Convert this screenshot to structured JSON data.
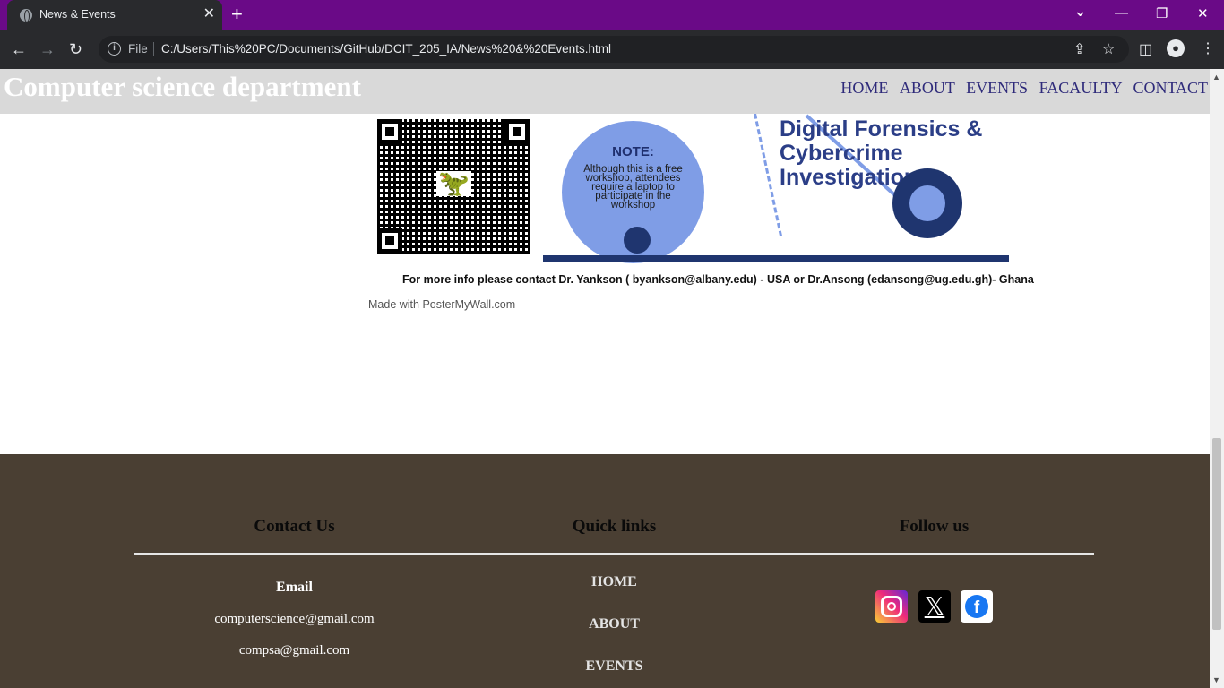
{
  "browser": {
    "tab_title": "News & Events",
    "tab_close": "✕",
    "new_tab": "+",
    "file_label": "File",
    "url": "C:/Users/This%20PC/Documents/GitHub/DCIT_205_IA/News%20&%20Events.html",
    "win_min": "—",
    "win_restore": "❐",
    "win_close": "✕",
    "tab_list": "⌄"
  },
  "site": {
    "brand": "Computer science department",
    "nav": [
      "HOME",
      "ABOUT",
      "EVENTS",
      "FACAULTY",
      "CONTACT"
    ]
  },
  "poster": {
    "note_title": "NOTE:",
    "note_text": "Although this is a free workshop, attendees require a laptop to participate in the workshop",
    "event_title_line1": "Digital Forensics &",
    "event_title_line2": "Cybercrime Investigation",
    "contact": "For more info please contact Dr. Yankson ( byankson@albany.edu) - USA   or Dr.Ansong (edansong@ug.edu.gh)- Ghana",
    "credit": "Made with PosterMyWall.com"
  },
  "footer": {
    "contact_heading": "Contact Us",
    "email_heading": "Email",
    "emails": [
      "computerscience@gmail.com",
      "compsa@gmail.com"
    ],
    "links_heading": "Quick links",
    "links": [
      "HOME",
      "ABOUT",
      "EVENTS"
    ],
    "follow_heading": "Follow us",
    "socials": [
      "instagram-icon",
      "x-icon",
      "facebook-icon"
    ]
  }
}
